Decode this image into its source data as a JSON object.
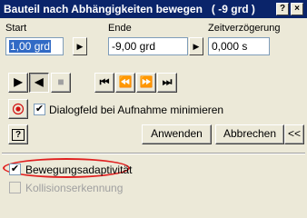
{
  "window": {
    "title": "Bauteil nach Abhängigkeiten bewegen   ( -9 grd )",
    "help_glyph": "?",
    "close_glyph": "×"
  },
  "params": {
    "start_label": "Start",
    "start_value": "1,00 grd",
    "end_label": "Ende",
    "end_value": "-9,00 grd",
    "delay_label": "Zeitverzögerung",
    "delay_value": "0,000 s"
  },
  "playback": {
    "forward": "▶",
    "reverse": "◀",
    "stop": "■",
    "go_start": "⏮",
    "step_back": "⏪",
    "step_fwd": "⏩",
    "go_end": "⏭"
  },
  "record": {
    "minimize_label": "Dialogfeld bei Aufnahme minimieren",
    "minimize_checked": true
  },
  "buttons": {
    "apply": "Anwenden",
    "cancel": "Abbrechen",
    "more": "<<",
    "help": "?"
  },
  "options": {
    "adaptivity_label": "Bewegungsadaptivität",
    "adaptivity_checked": true,
    "collision_label": "Kollisionserkennung",
    "collision_checked": false
  },
  "colors": {
    "title_bg": "#0a246a",
    "highlight_ring": "#e02020",
    "record_dot": "#d01010"
  }
}
